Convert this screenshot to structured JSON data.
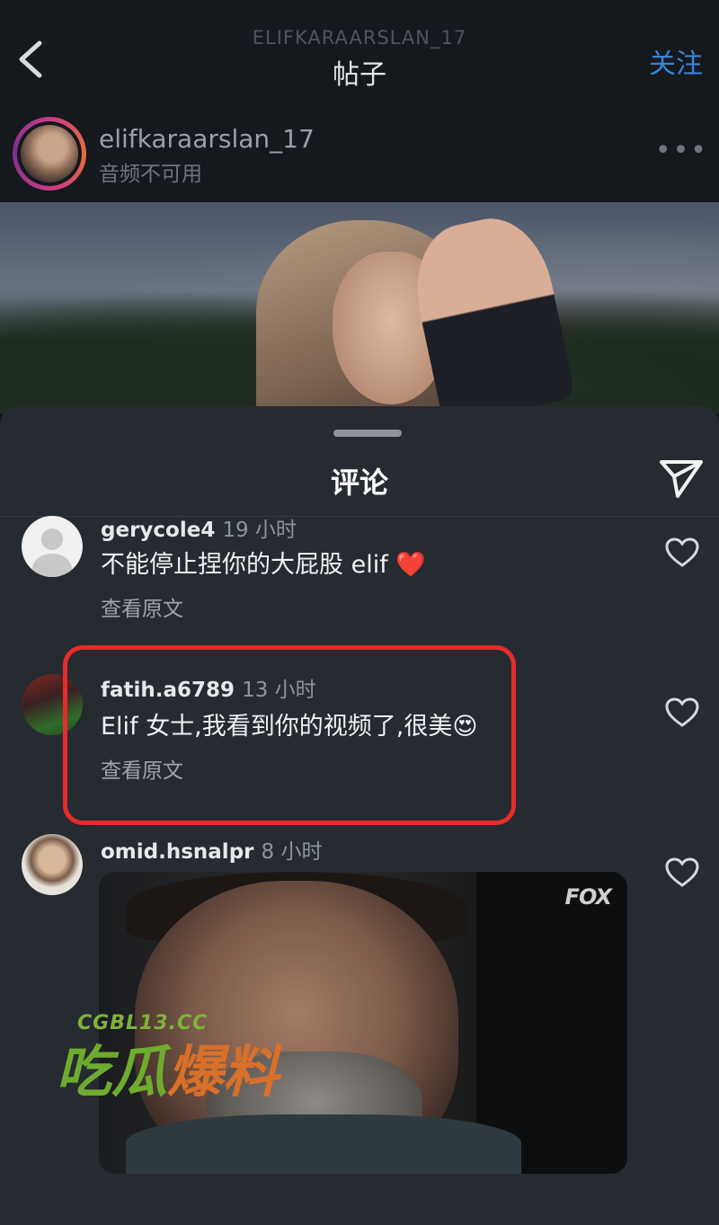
{
  "header": {
    "username": "ELIFKARAARSLAN_17",
    "title": "帖子",
    "follow_label": "关注"
  },
  "post": {
    "username": "elifkaraarslan_17",
    "subtitle": "音频不可用",
    "more_label": "•••"
  },
  "comments_sheet": {
    "title": "评论"
  },
  "comments": [
    {
      "username": "gerycole4",
      "time": "19 小时",
      "text": "不能停止捏你的大屁股 elif ❤️",
      "translate_label": "查看原文"
    },
    {
      "username": "fatih.a6789",
      "time": "13 小时",
      "text": "Elif 女士,我看到你的视频了,很美😍",
      "translate_label": "查看原文"
    },
    {
      "username": "omid.hsnalpr",
      "time": "8 小时",
      "gif_watermark": "FOX"
    }
  ],
  "watermark": {
    "url": "CGBL13.CC",
    "logo_part1": "吃瓜",
    "logo_part2": "爆料"
  },
  "colors": {
    "background": "#121418",
    "sheet": "#262a31",
    "follow": "#3a84d6",
    "highlight": "#e52b2b"
  }
}
